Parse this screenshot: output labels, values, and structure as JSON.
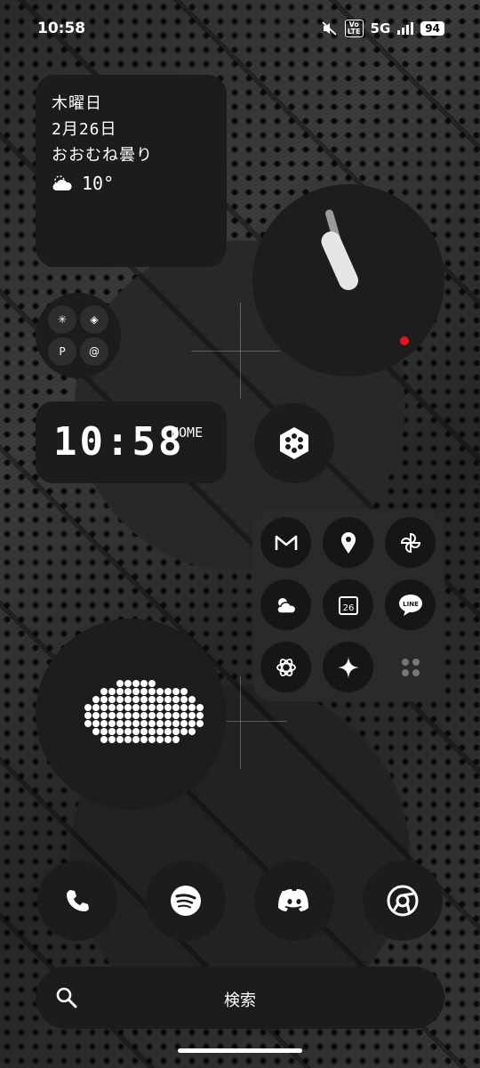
{
  "status_bar": {
    "time": "10:58",
    "volte": "Vo\nLTE",
    "network": "5G",
    "battery": "94"
  },
  "date_widget": {
    "weekday": "木曜日",
    "date": "2月26日",
    "condition": "おおむね曇り",
    "temperature": "10°"
  },
  "clock_widget": {
    "hour_hand_deg": -24,
    "minute_hand_deg": -16,
    "accent_color": "#e8141c"
  },
  "digital_clock": {
    "time": "10:58",
    "label": "HOME"
  },
  "app_folder": {
    "apps": [
      {
        "name": "Gmail",
        "icon": "gmail-icon",
        "glyph": "M"
      },
      {
        "name": "Maps",
        "icon": "map-pin-icon"
      },
      {
        "name": "Photos",
        "icon": "pinwheel-icon"
      },
      {
        "name": "Weather",
        "icon": "weather-icon"
      },
      {
        "name": "Calendar",
        "icon": "calendar-icon",
        "glyph": "26"
      },
      {
        "name": "LINE",
        "icon": "line-icon",
        "glyph": "LINE"
      },
      {
        "name": "ChatGPT",
        "icon": "openai-icon"
      },
      {
        "name": "Gemini",
        "icon": "sparkle-icon"
      },
      {
        "name": "More",
        "icon": "grid-dots-icon"
      }
    ]
  },
  "dock": [
    {
      "name": "Phone",
      "icon": "phone-icon"
    },
    {
      "name": "Spotify",
      "icon": "spotify-icon"
    },
    {
      "name": "Discord",
      "icon": "discord-icon"
    },
    {
      "name": "Chrome",
      "icon": "chrome-icon"
    }
  ],
  "search": {
    "label": "検索"
  }
}
